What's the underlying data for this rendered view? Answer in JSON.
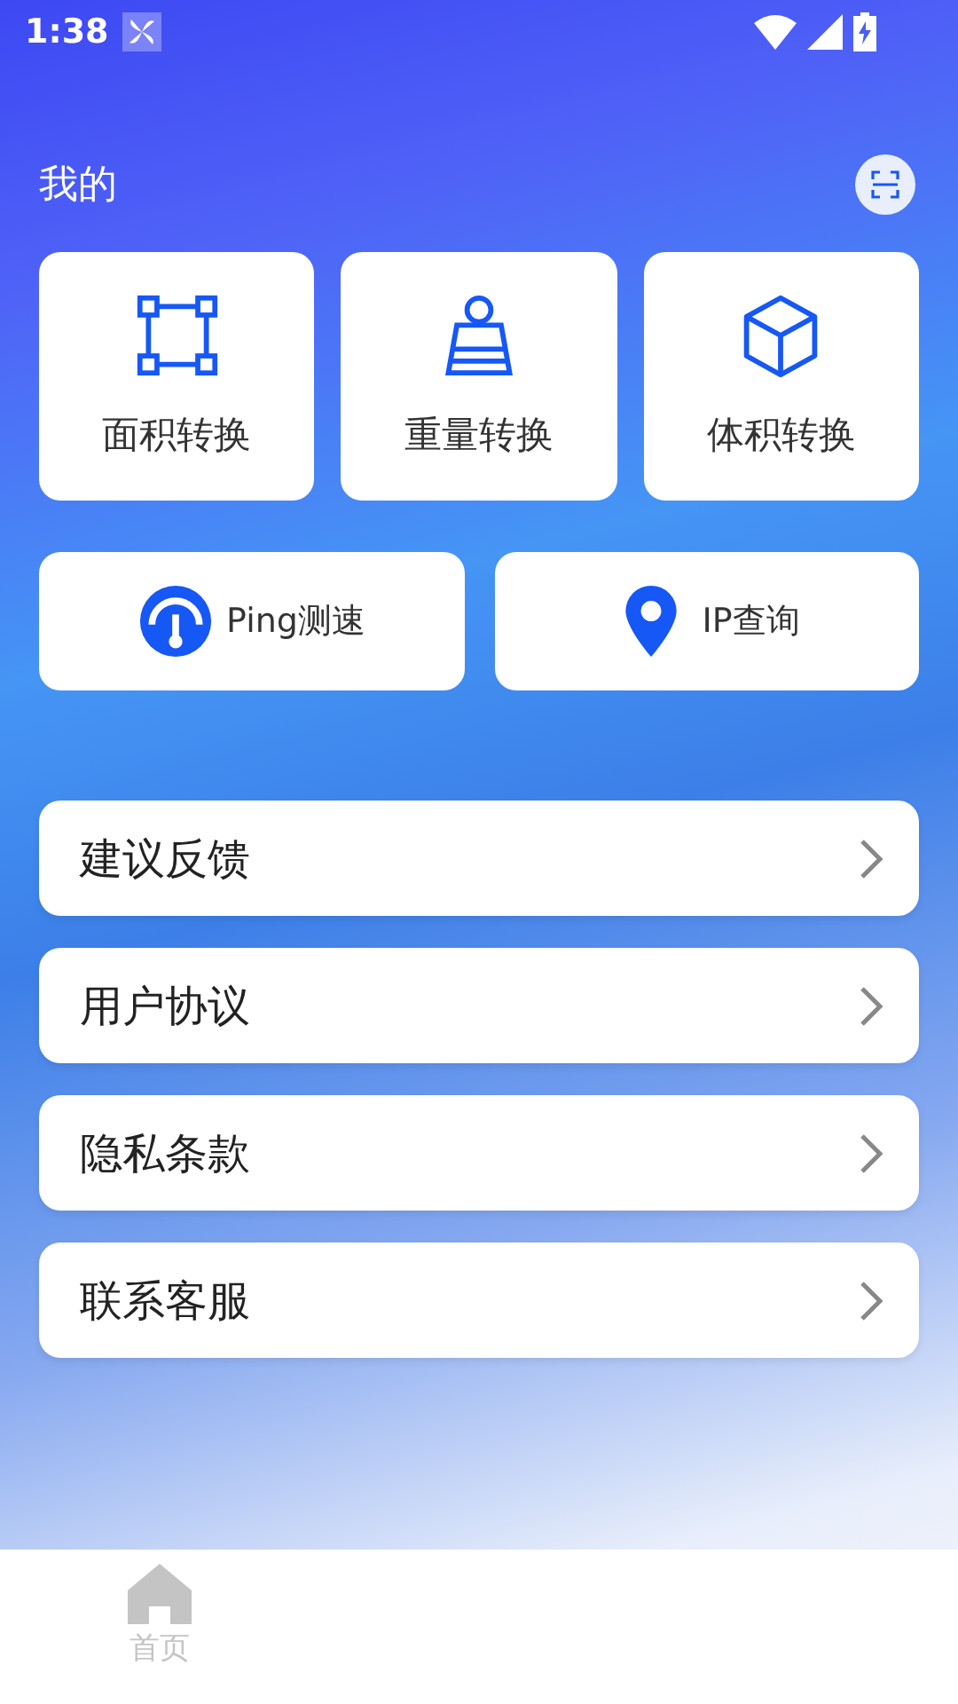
{
  "status_bar": {
    "time": "1:38"
  },
  "header": {
    "title": "我的"
  },
  "tools": [
    {
      "kind": "area",
      "label": "面积转换"
    },
    {
      "kind": "weight",
      "label": "重量转换"
    },
    {
      "kind": "volume",
      "label": "体积转换"
    }
  ],
  "quick_actions": [
    {
      "kind": "ping",
      "label": "Ping测速"
    },
    {
      "kind": "location",
      "label": "IP查询"
    }
  ],
  "menu": [
    {
      "label": "建议反馈"
    },
    {
      "label": "用户协议"
    },
    {
      "label": "隐私条款"
    },
    {
      "label": "联系客服"
    }
  ],
  "bottom_nav": [
    {
      "label": "首页"
    }
  ]
}
